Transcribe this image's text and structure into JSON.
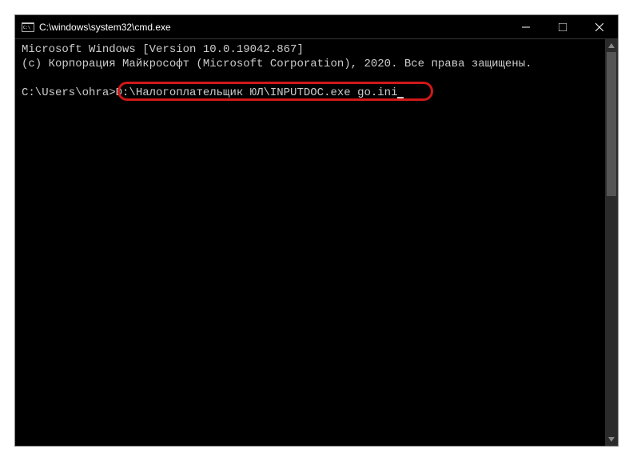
{
  "window": {
    "title": "C:\\windows\\system32\\cmd.exe"
  },
  "terminal": {
    "line1": "Microsoft Windows [Version 10.0.19042.867]",
    "line2": "(c) Корпорация Майкрософт (Microsoft Corporation), 2020. Все права защищены.",
    "prompt": "C:\\Users\\ohra",
    "prompt_separator": ">",
    "command": "D:\\Налогоплательщик ЮЛ\\INPUTDOC.exe go.ini"
  }
}
